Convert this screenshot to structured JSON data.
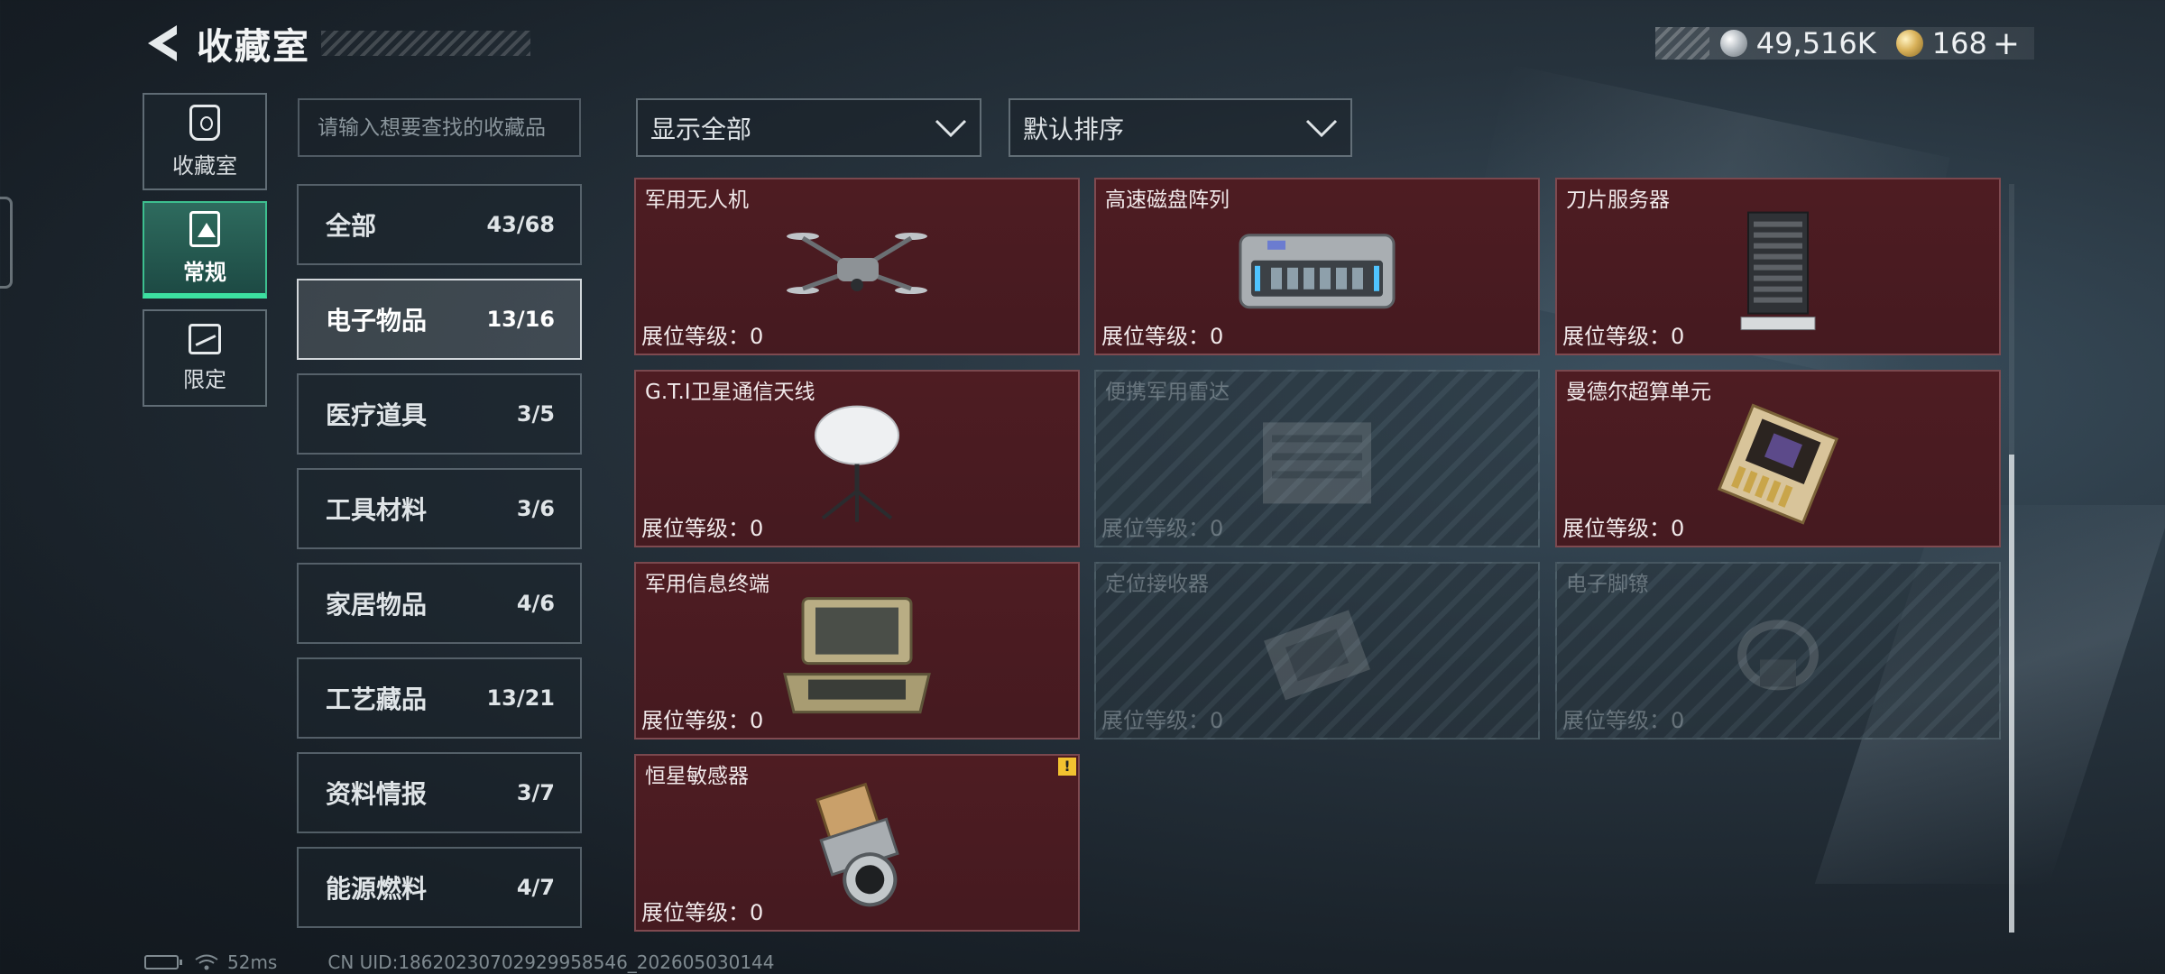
{
  "header": {
    "title": "收藏室"
  },
  "currency": {
    "silver": {
      "amount": "49,516K",
      "icon": "silver-coin-icon"
    },
    "gold": {
      "amount": "168",
      "icon": "gold-coin-icon"
    },
    "plus_label": "+"
  },
  "side_nav": [
    {
      "label": "收藏室",
      "icon": "trophy-icon",
      "active": false
    },
    {
      "label": "常规",
      "icon": "document-icon",
      "active": true
    },
    {
      "label": "限定",
      "icon": "limited-icon",
      "active": false
    }
  ],
  "search": {
    "placeholder": "请输入想要查找的收藏品",
    "value": ""
  },
  "filters": {
    "display": "显示全部",
    "sort": "默认排序"
  },
  "categories": [
    {
      "name": "全部",
      "count": "43/68",
      "active": false
    },
    {
      "name": "电子物品",
      "count": "13/16",
      "active": true
    },
    {
      "name": "医疗道具",
      "count": "3/5",
      "active": false
    },
    {
      "name": "工具材料",
      "count": "3/6",
      "active": false
    },
    {
      "name": "家居物品",
      "count": "4/6",
      "active": false
    },
    {
      "name": "工艺藏品",
      "count": "13/21",
      "active": false
    },
    {
      "name": "资料情报",
      "count": "3/7",
      "active": false
    },
    {
      "name": "能源燃料",
      "count": "4/7",
      "active": false
    }
  ],
  "items": [
    {
      "name": "军用无人机",
      "level": "展位等级：0",
      "owned": true,
      "icon": "drone-icon"
    },
    {
      "name": "高速磁盘阵列",
      "level": "展位等级：0",
      "owned": true,
      "icon": "disk-array-icon"
    },
    {
      "name": "刀片服务器",
      "level": "展位等级：0",
      "owned": true,
      "icon": "blade-server-icon"
    },
    {
      "name": "G.T.I卫星通信天线",
      "level": "展位等级：0",
      "owned": true,
      "icon": "satellite-dish-icon"
    },
    {
      "name": "便携军用雷达",
      "level": "展位等级：0",
      "owned": false,
      "icon": "radar-icon"
    },
    {
      "name": "曼德尔超算单元",
      "level": "展位等级：0",
      "owned": true,
      "icon": "compute-unit-icon"
    },
    {
      "name": "军用信息终端",
      "level": "展位等级：0",
      "owned": true,
      "icon": "terminal-case-icon"
    },
    {
      "name": "定位接收器",
      "level": "展位等级：0",
      "owned": false,
      "icon": "receiver-icon"
    },
    {
      "name": "电子脚镣",
      "level": "展位等级：0",
      "owned": false,
      "icon": "ankle-monitor-icon"
    },
    {
      "name": "恒星敏感器",
      "level": "展位等级：0",
      "owned": true,
      "icon": "star-sensor-icon",
      "badge": "!"
    }
  ],
  "status": {
    "ping": "52ms",
    "uid": "CN UID:18620230702929958546_202605030144"
  },
  "colors": {
    "owned_card": "#4e1c22",
    "active_nav": "#2e6b5e",
    "accent_green": "#3ce0a0",
    "warning": "#f2c230"
  }
}
